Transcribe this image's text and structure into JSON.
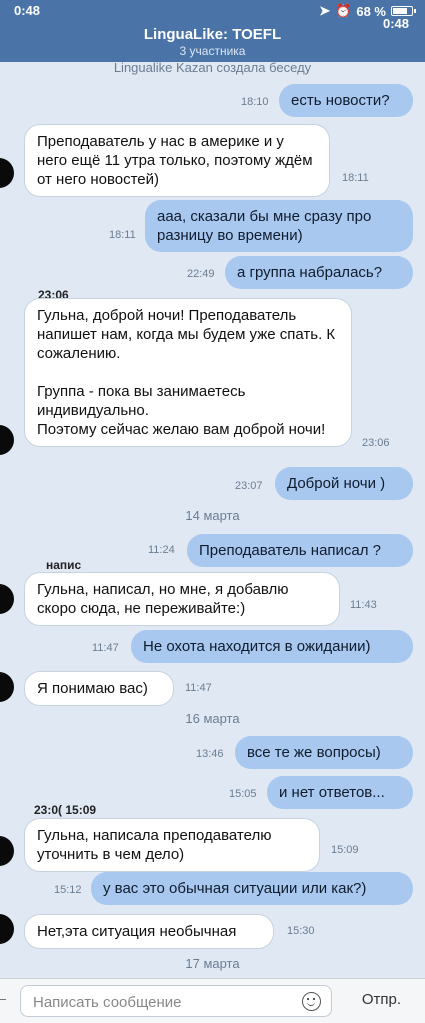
{
  "status_bar": {
    "time": "0:48",
    "battery": "68 %"
  },
  "header": {
    "title": "LinguaLike: TOEFL",
    "subtitle": "3 участника",
    "time": "0:48"
  },
  "system_top": "Lingualike Kazan создала беседу",
  "messages": [
    {
      "dir": "out",
      "text": "есть новости?",
      "time": "18:10"
    },
    {
      "dir": "in",
      "text": "Преподаватель у нас в америке и у него ещё 11 утра только, поэтому ждём от него новостей)",
      "time": "18:11"
    },
    {
      "dir": "out",
      "text": "ааа, сказали бы мне сразу про разницу во времени)",
      "time": "18:11"
    },
    {
      "dir": "out",
      "text": "а группа набралась?",
      "time": "22:49"
    },
    {
      "dir": "in",
      "text": "Гульна, доброй ночи! Преподаватель напишет нам, когда мы будем уже спать. К сожалению.\n\nГруппа - пока вы занимаетесь индивидуально.\nПоэтому сейчас желаю вам доброй ночи!",
      "time": "23:06"
    },
    {
      "dir": "out",
      "text": "Доброй ночи )",
      "time": "23:07"
    },
    {
      "dir": "out",
      "text": "Преподаватель написал ?",
      "time": "11:24"
    },
    {
      "dir": "in",
      "text": "Гульна, написал, но мне, я добавлю скоро сюда, не переживайте:)",
      "time": "11:43"
    },
    {
      "dir": "out",
      "text": "Не охота находится в ожидании)",
      "time": "11:47"
    },
    {
      "dir": "in",
      "text": "Я понимаю вас)",
      "time": "11:47"
    },
    {
      "dir": "out",
      "text": "все те же вопросы)",
      "time": "13:46"
    },
    {
      "dir": "out",
      "text": "и нет ответов...",
      "time": "15:05"
    },
    {
      "dir": "in",
      "text": "Гульна, написала преподавателю уточнить в чем дело)",
      "time": "15:09"
    },
    {
      "dir": "out",
      "text": "у вас это обычная ситуации или как?)",
      "time": "15:12"
    },
    {
      "dir": "in",
      "text": "Нет,эта ситуация необычная",
      "time": "15:30"
    }
  ],
  "dates": [
    "14 марта",
    "16 марта",
    "17 марта"
  ],
  "name_fragments": {
    "a": "23:06",
    "b": "напис",
    "c": "23:0( 15:09"
  },
  "composer": {
    "placeholder": "Написать сообщение",
    "send_label": "Отпр."
  },
  "colors": {
    "header": "#4a74a8",
    "outgoing": "#a9c8ef",
    "incoming": "#ffffff",
    "background": "#dfe8f3"
  }
}
